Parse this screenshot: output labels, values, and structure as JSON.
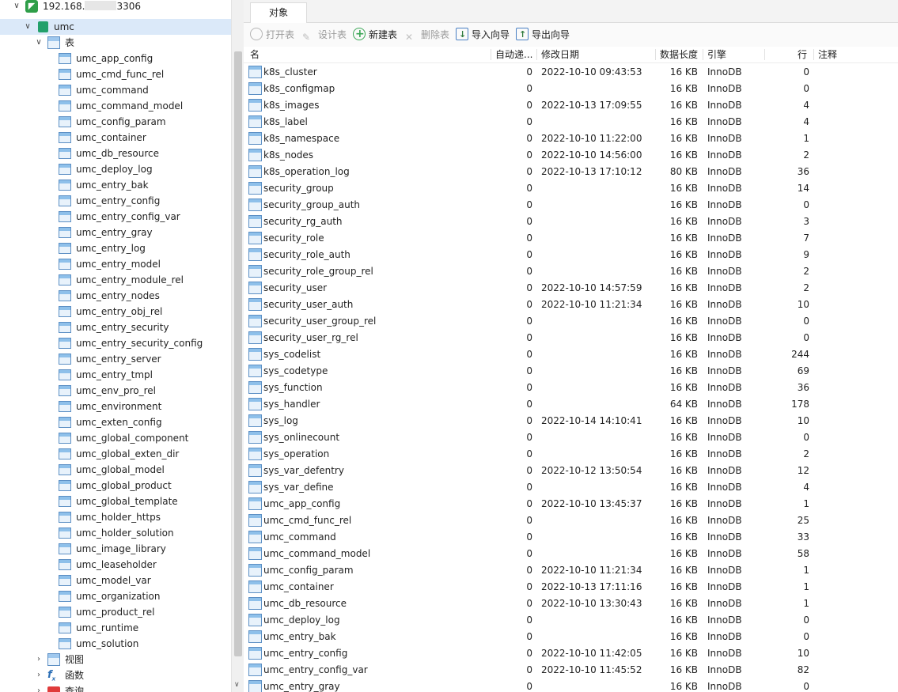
{
  "connection": {
    "name": "192.168.",
    "masked": "",
    "port": "3306"
  },
  "database": {
    "name": "umc"
  },
  "tree": {
    "tables_label": "表",
    "tables": [
      "umc_app_config",
      "umc_cmd_func_rel",
      "umc_command",
      "umc_command_model",
      "umc_config_param",
      "umc_container",
      "umc_db_resource",
      "umc_deploy_log",
      "umc_entry_bak",
      "umc_entry_config",
      "umc_entry_config_var",
      "umc_entry_gray",
      "umc_entry_log",
      "umc_entry_model",
      "umc_entry_module_rel",
      "umc_entry_nodes",
      "umc_entry_obj_rel",
      "umc_entry_security",
      "umc_entry_security_config",
      "umc_entry_server",
      "umc_entry_tmpl",
      "umc_env_pro_rel",
      "umc_environment",
      "umc_exten_config",
      "umc_global_component",
      "umc_global_exten_dir",
      "umc_global_model",
      "umc_global_product",
      "umc_global_template",
      "umc_holder_https",
      "umc_holder_solution",
      "umc_image_library",
      "umc_leaseholder",
      "umc_model_var",
      "umc_organization",
      "umc_product_rel",
      "umc_runtime",
      "umc_solution"
    ],
    "views_label": "视图",
    "functions_label": "函数",
    "queries_label": "查询"
  },
  "tabs": [
    {
      "label": "对象"
    }
  ],
  "toolbar": {
    "open_table": "打开表",
    "design_table": "设计表",
    "new_table": "新建表",
    "delete_table": "删除表",
    "import_wizard": "导入向导",
    "export_wizard": "导出向导"
  },
  "columns": {
    "name": "名",
    "auto_increment": "自动递...",
    "modified": "修改日期",
    "data_length": "数据长度",
    "engine": "引擎",
    "rows": "行",
    "comment": "注释"
  },
  "table_rows": [
    {
      "name": "k8s_cluster",
      "auto": "0",
      "date": "2022-10-10 09:43:53",
      "size": "16 KB",
      "engine": "InnoDB",
      "rows": "0"
    },
    {
      "name": "k8s_configmap",
      "auto": "0",
      "date": "",
      "size": "16 KB",
      "engine": "InnoDB",
      "rows": "0"
    },
    {
      "name": "k8s_images",
      "auto": "0",
      "date": "2022-10-13 17:09:55",
      "size": "16 KB",
      "engine": "InnoDB",
      "rows": "4"
    },
    {
      "name": "k8s_label",
      "auto": "0",
      "date": "",
      "size": "16 KB",
      "engine": "InnoDB",
      "rows": "4"
    },
    {
      "name": "k8s_namespace",
      "auto": "0",
      "date": "2022-10-10 11:22:00",
      "size": "16 KB",
      "engine": "InnoDB",
      "rows": "1"
    },
    {
      "name": "k8s_nodes",
      "auto": "0",
      "date": "2022-10-10 14:56:00",
      "size": "16 KB",
      "engine": "InnoDB",
      "rows": "2"
    },
    {
      "name": "k8s_operation_log",
      "auto": "0",
      "date": "2022-10-13 17:10:12",
      "size": "80 KB",
      "engine": "InnoDB",
      "rows": "36"
    },
    {
      "name": "security_group",
      "auto": "0",
      "date": "",
      "size": "16 KB",
      "engine": "InnoDB",
      "rows": "14"
    },
    {
      "name": "security_group_auth",
      "auto": "0",
      "date": "",
      "size": "16 KB",
      "engine": "InnoDB",
      "rows": "0"
    },
    {
      "name": "security_rg_auth",
      "auto": "0",
      "date": "",
      "size": "16 KB",
      "engine": "InnoDB",
      "rows": "3"
    },
    {
      "name": "security_role",
      "auto": "0",
      "date": "",
      "size": "16 KB",
      "engine": "InnoDB",
      "rows": "7"
    },
    {
      "name": "security_role_auth",
      "auto": "0",
      "date": "",
      "size": "16 KB",
      "engine": "InnoDB",
      "rows": "9"
    },
    {
      "name": "security_role_group_rel",
      "auto": "0",
      "date": "",
      "size": "16 KB",
      "engine": "InnoDB",
      "rows": "2"
    },
    {
      "name": "security_user",
      "auto": "0",
      "date": "2022-10-10 14:57:59",
      "size": "16 KB",
      "engine": "InnoDB",
      "rows": "2"
    },
    {
      "name": "security_user_auth",
      "auto": "0",
      "date": "2022-10-10 11:21:34",
      "size": "16 KB",
      "engine": "InnoDB",
      "rows": "10"
    },
    {
      "name": "security_user_group_rel",
      "auto": "0",
      "date": "",
      "size": "16 KB",
      "engine": "InnoDB",
      "rows": "0"
    },
    {
      "name": "security_user_rg_rel",
      "auto": "0",
      "date": "",
      "size": "16 KB",
      "engine": "InnoDB",
      "rows": "0"
    },
    {
      "name": "sys_codelist",
      "auto": "0",
      "date": "",
      "size": "16 KB",
      "engine": "InnoDB",
      "rows": "244"
    },
    {
      "name": "sys_codetype",
      "auto": "0",
      "date": "",
      "size": "16 KB",
      "engine": "InnoDB",
      "rows": "69"
    },
    {
      "name": "sys_function",
      "auto": "0",
      "date": "",
      "size": "16 KB",
      "engine": "InnoDB",
      "rows": "36"
    },
    {
      "name": "sys_handler",
      "auto": "0",
      "date": "",
      "size": "64 KB",
      "engine": "InnoDB",
      "rows": "178"
    },
    {
      "name": "sys_log",
      "auto": "0",
      "date": "2022-10-14 14:10:41",
      "size": "16 KB",
      "engine": "InnoDB",
      "rows": "10"
    },
    {
      "name": "sys_onlinecount",
      "auto": "0",
      "date": "",
      "size": "16 KB",
      "engine": "InnoDB",
      "rows": "0"
    },
    {
      "name": "sys_operation",
      "auto": "0",
      "date": "",
      "size": "16 KB",
      "engine": "InnoDB",
      "rows": "2"
    },
    {
      "name": "sys_var_defentry",
      "auto": "0",
      "date": "2022-10-12 13:50:54",
      "size": "16 KB",
      "engine": "InnoDB",
      "rows": "12"
    },
    {
      "name": "sys_var_define",
      "auto": "0",
      "date": "",
      "size": "16 KB",
      "engine": "InnoDB",
      "rows": "4"
    },
    {
      "name": "umc_app_config",
      "auto": "0",
      "date": "2022-10-10 13:45:37",
      "size": "16 KB",
      "engine": "InnoDB",
      "rows": "1"
    },
    {
      "name": "umc_cmd_func_rel",
      "auto": "0",
      "date": "",
      "size": "16 KB",
      "engine": "InnoDB",
      "rows": "25"
    },
    {
      "name": "umc_command",
      "auto": "0",
      "date": "",
      "size": "16 KB",
      "engine": "InnoDB",
      "rows": "33"
    },
    {
      "name": "umc_command_model",
      "auto": "0",
      "date": "",
      "size": "16 KB",
      "engine": "InnoDB",
      "rows": "58"
    },
    {
      "name": "umc_config_param",
      "auto": "0",
      "date": "2022-10-10 11:21:34",
      "size": "16 KB",
      "engine": "InnoDB",
      "rows": "1"
    },
    {
      "name": "umc_container",
      "auto": "0",
      "date": "2022-10-13 17:11:16",
      "size": "16 KB",
      "engine": "InnoDB",
      "rows": "1"
    },
    {
      "name": "umc_db_resource",
      "auto": "0",
      "date": "2022-10-10 13:30:43",
      "size": "16 KB",
      "engine": "InnoDB",
      "rows": "1"
    },
    {
      "name": "umc_deploy_log",
      "auto": "0",
      "date": "",
      "size": "16 KB",
      "engine": "InnoDB",
      "rows": "0"
    },
    {
      "name": "umc_entry_bak",
      "auto": "0",
      "date": "",
      "size": "16 KB",
      "engine": "InnoDB",
      "rows": "0"
    },
    {
      "name": "umc_entry_config",
      "auto": "0",
      "date": "2022-10-10 11:42:05",
      "size": "16 KB",
      "engine": "InnoDB",
      "rows": "10"
    },
    {
      "name": "umc_entry_config_var",
      "auto": "0",
      "date": "2022-10-10 11:45:52",
      "size": "16 KB",
      "engine": "InnoDB",
      "rows": "82"
    },
    {
      "name": "umc_entry_gray",
      "auto": "0",
      "date": "",
      "size": "16 KB",
      "engine": "InnoDB",
      "rows": "0"
    }
  ],
  "colors": {
    "selection": "#dbe9f9",
    "db_icon": "#22a06b",
    "connection_icon": "#2e9e48"
  }
}
